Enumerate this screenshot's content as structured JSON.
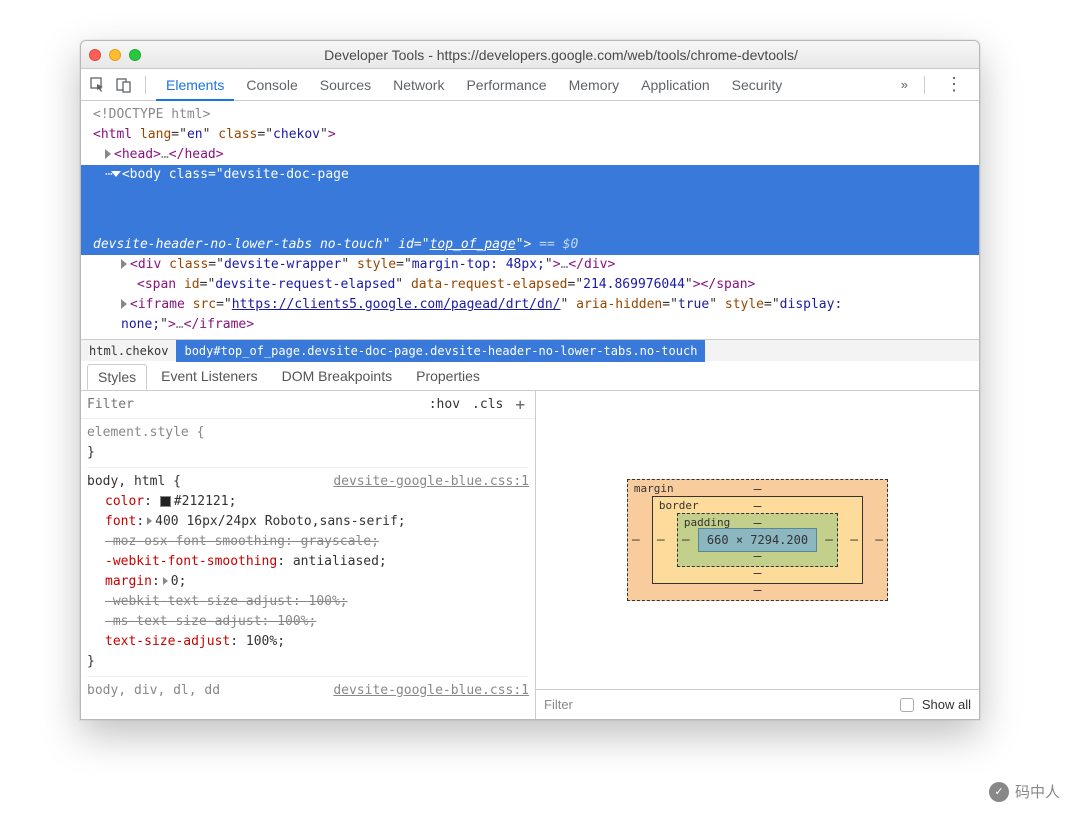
{
  "window": {
    "title": "Developer Tools - https://developers.google.com/web/tools/chrome-devtools/"
  },
  "tabs": [
    "Elements",
    "Console",
    "Sources",
    "Network",
    "Performance",
    "Memory",
    "Application",
    "Security"
  ],
  "active_tab": "Elements",
  "dom": {
    "doctype": "<!DOCTYPE html>",
    "html_open": "<html lang=\"en\" class=\"chekov\">",
    "head": "<head>…</head>",
    "body_open_1": "<body class=\"devsite-doc-page",
    "body_open_2": "devsite-header-no-lower-tabs no-touch\" id=\"top_of_page\"> == $0",
    "div_wrapper": "<div class=\"devsite-wrapper\" style=\"margin-top: 48px;\">…</div>",
    "span_elapsed": "<span id=\"devsite-request-elapsed\" data-request-elapsed=\"214.869976044\"></span>",
    "iframe_open": "<iframe src=\"https://clients5.google.com/pagead/drt/dn/\" aria-hidden=\"true\" style=\"display:",
    "iframe_close": "none;\">…</iframe>"
  },
  "breadcrumbs": {
    "a": "html.chekov",
    "b": "body#top_of_page.devsite-doc-page.devsite-header-no-lower-tabs.no-touch"
  },
  "subtabs": [
    "Styles",
    "Event Listeners",
    "DOM Breakpoints",
    "Properties"
  ],
  "styles": {
    "filter_placeholder": "Filter",
    "hov": ":hov",
    "cls": ".cls",
    "element_style": "element.style {",
    "brace_close": "}",
    "rule2_sel": "body, html {",
    "rule2_src": "devsite-google-blue.css:1",
    "props": {
      "color_n": "color",
      "color_v": "#212121;",
      "font_n": "font",
      "font_v": "400 16px/24px Roboto,sans-serif;",
      "moz": "-moz-osx-font-smoothing: grayscale;",
      "webkit_fs_n": "-webkit-font-smoothing",
      "webkit_fs_v": "antialiased;",
      "margin_n": "margin",
      "margin_v": "0;",
      "webkit_tsa": "-webkit-text-size-adjust: 100%;",
      "ms_tsa": "-ms-text-size-adjust: 100%;",
      "tsa_n": "text-size-adjust",
      "tsa_v": "100%;"
    },
    "rule3_sel": "body, div, dl, dd",
    "rule3_src": "devsite-google-blue.css:1"
  },
  "box": {
    "margin": "margin",
    "border": "border",
    "padding": "padding",
    "content": "660 × 7294.200",
    "dash": "–"
  },
  "computed": {
    "filter": "Filter",
    "show_all": "Show all"
  },
  "watermark": "码中人"
}
